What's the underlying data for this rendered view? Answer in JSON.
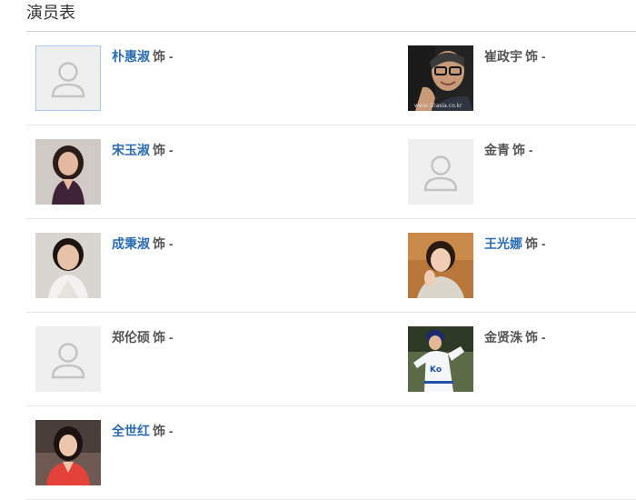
{
  "section_title": "演员表",
  "role_suffix": "饰 -",
  "cast": [
    {
      "name": "朴惠淑",
      "linked": true,
      "photo": "placeholder"
    },
    {
      "name": "崔政宇",
      "linked": false,
      "photo": "man-glasses",
      "watermark": "www.10asia.co.kr"
    },
    {
      "name": "宋玉淑",
      "linked": true,
      "photo": "woman-purple"
    },
    {
      "name": "金青",
      "linked": false,
      "photo": "placeholder"
    },
    {
      "name": "成秉淑",
      "linked": true,
      "photo": "woman-white"
    },
    {
      "name": "王光娜",
      "linked": true,
      "photo": "woman-short-hair"
    },
    {
      "name": "郑伦硕",
      "linked": false,
      "photo": "placeholder"
    },
    {
      "name": "金贤洙",
      "linked": false,
      "photo": "baseball-player"
    },
    {
      "name": "全世红",
      "linked": true,
      "photo": "woman-red"
    }
  ]
}
